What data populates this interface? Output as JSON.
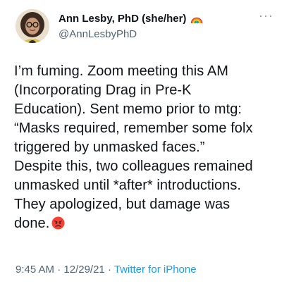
{
  "author": {
    "name": "Ann Lesby, PhD (she/her)",
    "handle": "@AnnLesbyPhD",
    "name_emoji": "rainbow-icon",
    "avatar": "avatar"
  },
  "more_label": "···",
  "tweet": {
    "lines": [
      "I’m fuming. Zoom meeting this AM",
      "(Incorporating Drag in Pre-K",
      "Education). Sent memo prior to mtg:",
      "“Masks required, remember some folx",
      "triggered by unmasked faces.”",
      "Despite this, two colleagues remained",
      "unmasked until *after* introductions.",
      "They apologized, but damage was",
      "done."
    ],
    "trailing_emoji": "angry-face-icon"
  },
  "meta": {
    "time": "9:45 AM",
    "sep1": " · ",
    "date": "12/29/21",
    "sep2": " · ",
    "source": "Twitter for iPhone"
  },
  "colors": {
    "text": "#0f1419",
    "secondary": "#536471",
    "link": "#1d9bf0"
  }
}
